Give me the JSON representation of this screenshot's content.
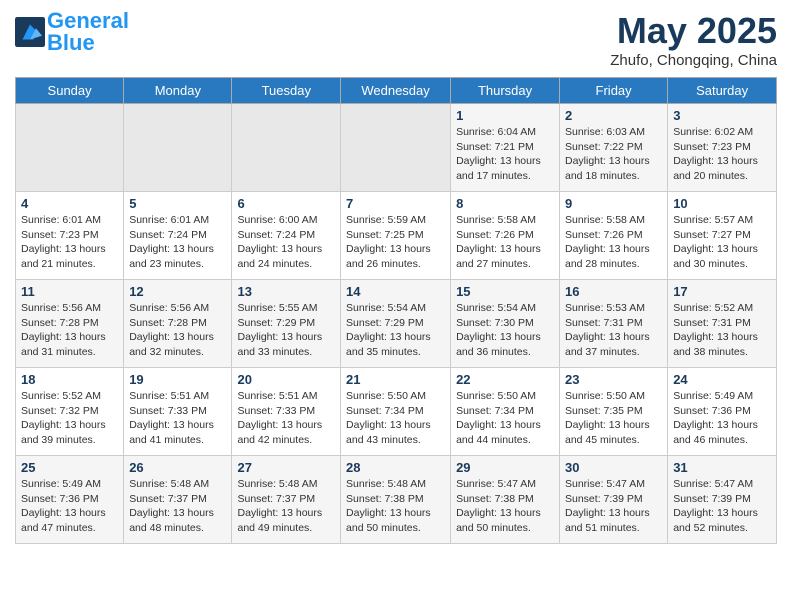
{
  "header": {
    "logo_general": "General",
    "logo_blue": "Blue",
    "month_title": "May 2025",
    "location": "Zhufo, Chongqing, China"
  },
  "weekdays": [
    "Sunday",
    "Monday",
    "Tuesday",
    "Wednesday",
    "Thursday",
    "Friday",
    "Saturday"
  ],
  "weeks": [
    [
      {
        "day": "",
        "empty": true
      },
      {
        "day": "",
        "empty": true
      },
      {
        "day": "",
        "empty": true
      },
      {
        "day": "",
        "empty": true
      },
      {
        "day": "1",
        "sunrise": "6:04 AM",
        "sunset": "7:21 PM",
        "daylight": "13 hours and 17 minutes."
      },
      {
        "day": "2",
        "sunrise": "6:03 AM",
        "sunset": "7:22 PM",
        "daylight": "13 hours and 18 minutes."
      },
      {
        "day": "3",
        "sunrise": "6:02 AM",
        "sunset": "7:23 PM",
        "daylight": "13 hours and 20 minutes."
      }
    ],
    [
      {
        "day": "4",
        "sunrise": "6:01 AM",
        "sunset": "7:23 PM",
        "daylight": "13 hours and 21 minutes."
      },
      {
        "day": "5",
        "sunrise": "6:01 AM",
        "sunset": "7:24 PM",
        "daylight": "13 hours and 23 minutes."
      },
      {
        "day": "6",
        "sunrise": "6:00 AM",
        "sunset": "7:24 PM",
        "daylight": "13 hours and 24 minutes."
      },
      {
        "day": "7",
        "sunrise": "5:59 AM",
        "sunset": "7:25 PM",
        "daylight": "13 hours and 26 minutes."
      },
      {
        "day": "8",
        "sunrise": "5:58 AM",
        "sunset": "7:26 PM",
        "daylight": "13 hours and 27 minutes."
      },
      {
        "day": "9",
        "sunrise": "5:58 AM",
        "sunset": "7:26 PM",
        "daylight": "13 hours and 28 minutes."
      },
      {
        "day": "10",
        "sunrise": "5:57 AM",
        "sunset": "7:27 PM",
        "daylight": "13 hours and 30 minutes."
      }
    ],
    [
      {
        "day": "11",
        "sunrise": "5:56 AM",
        "sunset": "7:28 PM",
        "daylight": "13 hours and 31 minutes."
      },
      {
        "day": "12",
        "sunrise": "5:56 AM",
        "sunset": "7:28 PM",
        "daylight": "13 hours and 32 minutes."
      },
      {
        "day": "13",
        "sunrise": "5:55 AM",
        "sunset": "7:29 PM",
        "daylight": "13 hours and 33 minutes."
      },
      {
        "day": "14",
        "sunrise": "5:54 AM",
        "sunset": "7:29 PM",
        "daylight": "13 hours and 35 minutes."
      },
      {
        "day": "15",
        "sunrise": "5:54 AM",
        "sunset": "7:30 PM",
        "daylight": "13 hours and 36 minutes."
      },
      {
        "day": "16",
        "sunrise": "5:53 AM",
        "sunset": "7:31 PM",
        "daylight": "13 hours and 37 minutes."
      },
      {
        "day": "17",
        "sunrise": "5:52 AM",
        "sunset": "7:31 PM",
        "daylight": "13 hours and 38 minutes."
      }
    ],
    [
      {
        "day": "18",
        "sunrise": "5:52 AM",
        "sunset": "7:32 PM",
        "daylight": "13 hours and 39 minutes."
      },
      {
        "day": "19",
        "sunrise": "5:51 AM",
        "sunset": "7:33 PM",
        "daylight": "13 hours and 41 minutes."
      },
      {
        "day": "20",
        "sunrise": "5:51 AM",
        "sunset": "7:33 PM",
        "daylight": "13 hours and 42 minutes."
      },
      {
        "day": "21",
        "sunrise": "5:50 AM",
        "sunset": "7:34 PM",
        "daylight": "13 hours and 43 minutes."
      },
      {
        "day": "22",
        "sunrise": "5:50 AM",
        "sunset": "7:34 PM",
        "daylight": "13 hours and 44 minutes."
      },
      {
        "day": "23",
        "sunrise": "5:50 AM",
        "sunset": "7:35 PM",
        "daylight": "13 hours and 45 minutes."
      },
      {
        "day": "24",
        "sunrise": "5:49 AM",
        "sunset": "7:36 PM",
        "daylight": "13 hours and 46 minutes."
      }
    ],
    [
      {
        "day": "25",
        "sunrise": "5:49 AM",
        "sunset": "7:36 PM",
        "daylight": "13 hours and 47 minutes."
      },
      {
        "day": "26",
        "sunrise": "5:48 AM",
        "sunset": "7:37 PM",
        "daylight": "13 hours and 48 minutes."
      },
      {
        "day": "27",
        "sunrise": "5:48 AM",
        "sunset": "7:37 PM",
        "daylight": "13 hours and 49 minutes."
      },
      {
        "day": "28",
        "sunrise": "5:48 AM",
        "sunset": "7:38 PM",
        "daylight": "13 hours and 50 minutes."
      },
      {
        "day": "29",
        "sunrise": "5:47 AM",
        "sunset": "7:38 PM",
        "daylight": "13 hours and 50 minutes."
      },
      {
        "day": "30",
        "sunrise": "5:47 AM",
        "sunset": "7:39 PM",
        "daylight": "13 hours and 51 minutes."
      },
      {
        "day": "31",
        "sunrise": "5:47 AM",
        "sunset": "7:39 PM",
        "daylight": "13 hours and 52 minutes."
      }
    ]
  ]
}
